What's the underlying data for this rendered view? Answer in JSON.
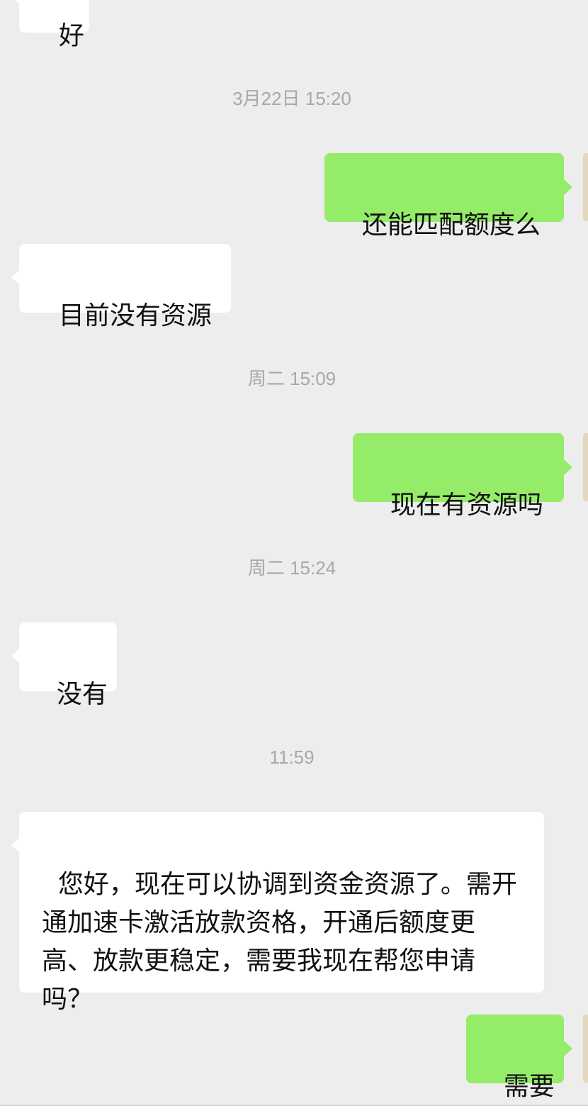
{
  "chat": {
    "messages": [
      {
        "type": "bubble",
        "side": "in",
        "text": "好"
      },
      {
        "type": "timestamp",
        "text": "3月22日 15:20"
      },
      {
        "type": "bubble",
        "side": "out",
        "text": "还能匹配额度么"
      },
      {
        "type": "bubble",
        "side": "in",
        "text": "目前没有资源"
      },
      {
        "type": "timestamp",
        "text": "周二 15:09"
      },
      {
        "type": "bubble",
        "side": "out",
        "text": "现在有资源吗"
      },
      {
        "type": "timestamp",
        "text": "周二 15:24"
      },
      {
        "type": "bubble",
        "side": "in",
        "text": "没有"
      },
      {
        "type": "timestamp",
        "text": "11:59"
      },
      {
        "type": "bubble",
        "side": "in",
        "text": "您好，现在可以协调到资金资源了。需开通加速卡激活放款资格，开通后额度更高、放款更稳定，需要我现在帮您申请吗？"
      },
      {
        "type": "bubble",
        "side": "out",
        "text": "需要"
      }
    ]
  },
  "colors": {
    "background": "#ededed",
    "incoming_bubble": "#ffffff",
    "outgoing_bubble": "#95ec69",
    "timestamp_text": "#a8a8a8",
    "message_text": "#111111"
  }
}
